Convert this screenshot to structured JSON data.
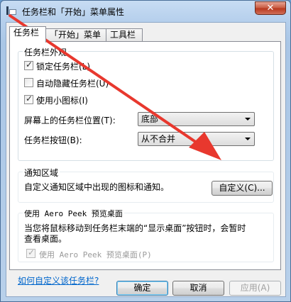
{
  "window": {
    "title": "任务栏和「开始」菜单属性",
    "close_glyph": "✕"
  },
  "tabs": [
    {
      "label": "任务栏",
      "active": true
    },
    {
      "label": "「开始」菜单",
      "active": false
    },
    {
      "label": "工具栏",
      "active": false
    }
  ],
  "appearance": {
    "title": "任务栏外观",
    "lock": {
      "label": "锁定任务栏(L)",
      "checked": true
    },
    "autohide": {
      "label": "自动隐藏任务栏(U)",
      "checked": false
    },
    "small_icons": {
      "label": "使用小图标(I)",
      "checked": true
    },
    "location": {
      "label": "屏幕上的任务栏位置(T):",
      "value": "底部"
    },
    "buttons": {
      "label": "任务栏按钮(B):",
      "value": "从不合并"
    }
  },
  "notification": {
    "title": "通知区域",
    "desc": "自定义通知区域中出现的图标和通知。",
    "customize_button": "自定义(C)..."
  },
  "peek": {
    "title": "使用 Aero Peek 预览桌面",
    "desc_line1": "当您将鼠标移动到任务栏末端的“显示桌面”按钮时，会暂时",
    "desc_line2": "查看桌面。",
    "checkbox": {
      "label": "使用 Aero Peek 预览桌面(P)",
      "checked": true,
      "enabled": false
    }
  },
  "help_link": "如何自定义该任务栏?",
  "footer": {
    "ok": "确定",
    "cancel": "取消",
    "apply": "应用(A)"
  },
  "colors": {
    "annotation_arrow": "#e8382e",
    "link": "#0066cc"
  }
}
